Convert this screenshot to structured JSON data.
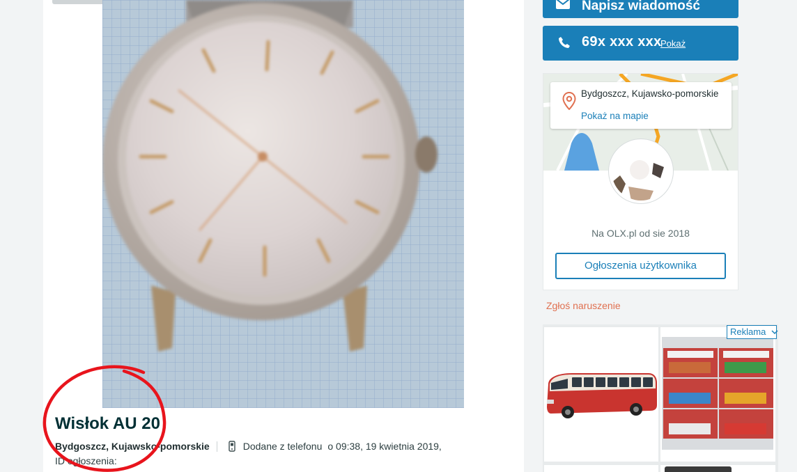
{
  "listing": {
    "title": "Wisłok AU 20",
    "location": "Bydgoszcz, Kujawsko-pomorskie",
    "added_via": "Dodane z telefonu",
    "added_at": "o 09:38, 19 kwietnia 2019,",
    "id_label": "ID ogłoszenia:"
  },
  "contact": {
    "message_label": "Napisz wiadomość",
    "phone_masked": "69x xxx xxx",
    "show_label": "Pokaż"
  },
  "seller": {
    "location": "Bydgoszcz, Kujawsko-pomorskie",
    "map_link": "Pokaż na mapie",
    "member_since": "Na OLX.pl od sie 2018",
    "user_ads_label": "Ogłoszenia użytkownika"
  },
  "report_label": "Zgłoś naruszenie",
  "ad_badge": "Reklama",
  "colors": {
    "accent": "#1a7fb8",
    "report": "#e07050",
    "annotation": "#e8141c"
  }
}
